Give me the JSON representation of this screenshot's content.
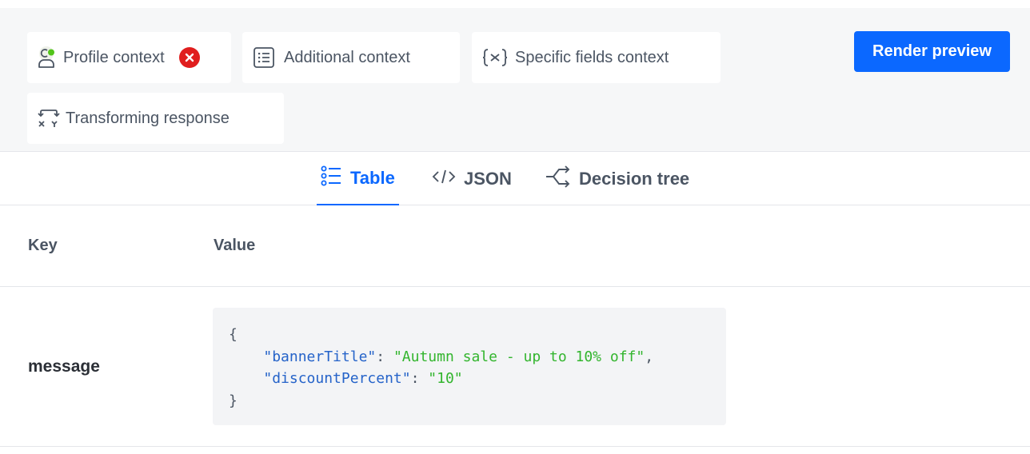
{
  "context_chips": {
    "profile": {
      "label": "Profile context",
      "icon": "profile-context-icon",
      "status_color": "#52c41a"
    },
    "additional": {
      "label": "Additional context",
      "icon": "list-icon"
    },
    "specific": {
      "label": "Specific fields context",
      "icon": "variable-icon"
    },
    "transforming": {
      "label": "Transforming response",
      "icon": "transform-icon"
    }
  },
  "render_button": {
    "label": "Render preview",
    "color": "#0b68ff"
  },
  "tabs": [
    {
      "label": "Table",
      "icon": "list-bullets-icon",
      "active": true
    },
    {
      "label": "JSON",
      "icon": "code-icon",
      "active": false
    },
    {
      "label": "Decision tree",
      "icon": "decision-tree-icon",
      "active": false
    }
  ],
  "table": {
    "headers": {
      "key": "Key",
      "value": "Value"
    },
    "rows": [
      {
        "key": "message",
        "value": {
          "open": "{",
          "close": "}",
          "entries": [
            {
              "key": "\"bannerTitle\"",
              "value": "\"Autumn sale - up to 10% off\"",
              "trailing": ","
            },
            {
              "key": "\"discountPercent\"",
              "value": "\"10\"",
              "trailing": ""
            }
          ]
        }
      }
    ]
  },
  "colors": {
    "accent": "#0b68ff",
    "error": "#e01e1e",
    "json_key": "#2563c9",
    "json_string": "#33b52e"
  }
}
